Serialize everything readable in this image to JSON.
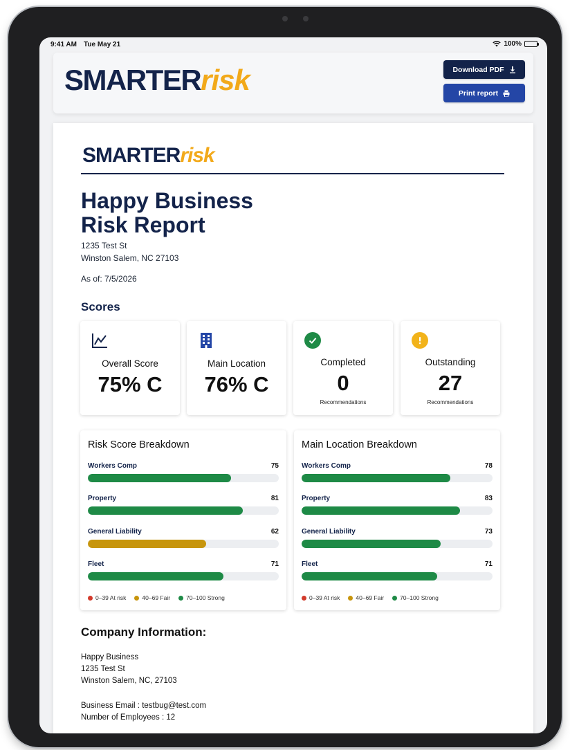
{
  "status_bar": {
    "time": "9:41 AM",
    "date": "Tue May 21",
    "battery": "100%"
  },
  "brand": {
    "logo_main": "SMARTER",
    "logo_accent": "risk",
    "colors": {
      "navy": "#13234a",
      "gold": "#f2a91a"
    }
  },
  "header": {
    "download_label": "Download PDF",
    "download_icon": "download-icon",
    "print_label": "Print report",
    "print_icon": "printer-icon"
  },
  "report": {
    "title_line1": "Happy Business",
    "title_line2": "Risk Report",
    "address_line1": "1235 Test St",
    "address_line2": "Winston Salem, NC 27103",
    "as_of": "As of: 7/5/2026"
  },
  "scores": {
    "heading": "Scores",
    "cards": [
      {
        "label": "Overall Score",
        "value": "75% C",
        "icon": "line-chart-icon"
      },
      {
        "label": "Main Location",
        "value": "76% C",
        "icon": "building-icon"
      },
      {
        "label": "Completed",
        "value": "0",
        "sub": "Recommendations",
        "icon": "check-circle-icon"
      },
      {
        "label": "Outstanding",
        "value": "27",
        "sub": "Recommendations",
        "icon": "warning-circle-icon"
      }
    ]
  },
  "breakdowns": [
    {
      "title": "Risk Score Breakdown",
      "rows": [
        {
          "label": "Workers Comp",
          "value": 75
        },
        {
          "label": "Property",
          "value": 81
        },
        {
          "label": "General Liability",
          "value": 62
        },
        {
          "label": "Fleet",
          "value": 71
        }
      ]
    },
    {
      "title": "Main Location Breakdown",
      "rows": [
        {
          "label": "Workers Comp",
          "value": 78
        },
        {
          "label": "Property",
          "value": 83
        },
        {
          "label": "General Liability",
          "value": 73
        },
        {
          "label": "Fleet",
          "value": 71
        }
      ]
    }
  ],
  "legend": [
    {
      "label": "0–39 At risk",
      "color": "#d23a2b"
    },
    {
      "label": "40–69 Fair",
      "color": "#c7950c"
    },
    {
      "label": "70–100 Strong",
      "color": "#1e8a46"
    }
  ],
  "company": {
    "heading": "Company Information:",
    "name": "Happy Business",
    "street": "1235 Test St",
    "city": "Winston Salem, NC, 27103",
    "email": "Business Email : testbug@test.com",
    "employees": "Number of Employees : 12"
  }
}
